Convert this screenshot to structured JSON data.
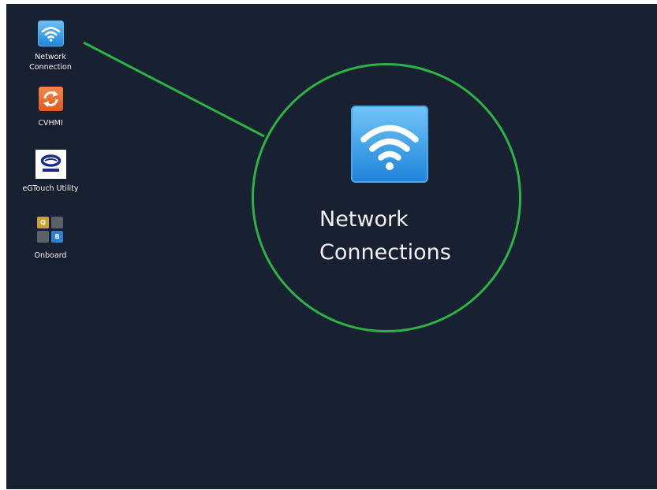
{
  "desktop": {
    "background_color": "#172131",
    "icons": [
      {
        "label": "Network\nConnection",
        "icon": "wifi-icon"
      },
      {
        "label": "CVHMI",
        "icon": "refresh-icon"
      },
      {
        "label": "eGTouch Utility",
        "icon": "egtouch-logo-icon"
      },
      {
        "label": "Onboard",
        "icon": "keyboard-icon"
      }
    ]
  },
  "callout": {
    "label_line1": "Network",
    "label_line2": "Connections",
    "icon": "wifi-icon",
    "highlight_color": "#2db244"
  }
}
